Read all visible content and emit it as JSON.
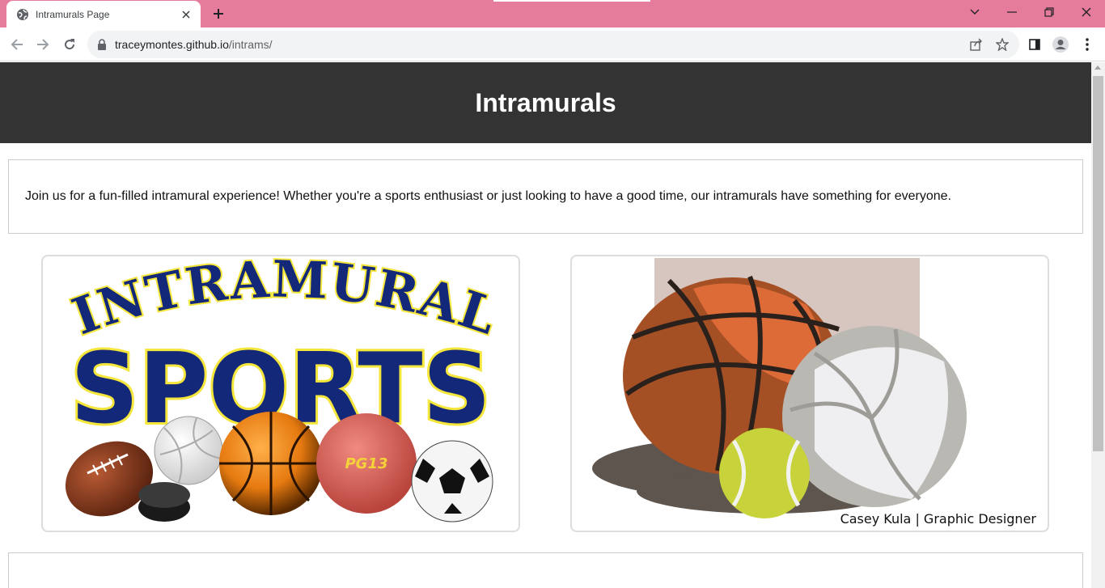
{
  "browser": {
    "tab_title": "Intramurals Page",
    "url_host": "traceymontes.github.io",
    "url_path": "/intrams/",
    "accent": "#e57c9b"
  },
  "page": {
    "heading": "Intramurals",
    "intro_text": "Join us for a fun-filled intramural experience! Whether you're a sports enthusiast or just looking to have a good time, our intramurals have something for everyone.",
    "image1": {
      "alt_text_line1": "INTRAMURAL",
      "alt_text_line2": "SPORTS",
      "ball_label": "PG13"
    },
    "image2": {
      "credit": "Casey Kula | Graphic Designer"
    }
  }
}
